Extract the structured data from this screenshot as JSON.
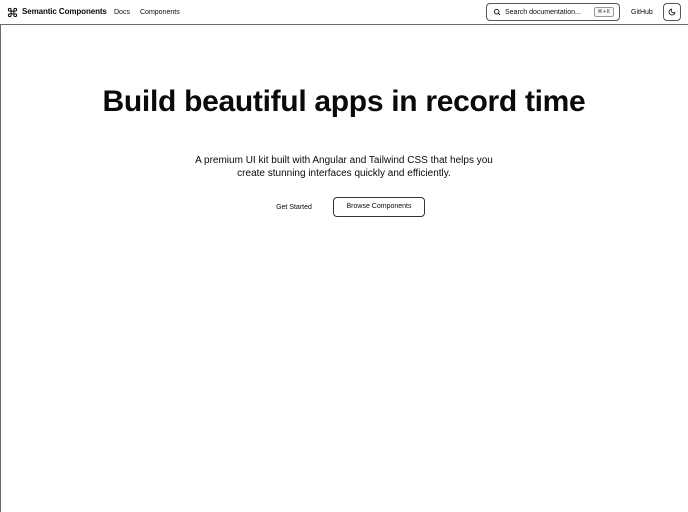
{
  "header": {
    "brand": "Semantic Components",
    "brand_icon": "command-icon",
    "nav": [
      "Docs",
      "Components"
    ],
    "search": {
      "placeholder": "Search documentation...",
      "shortcut": "⌘+K",
      "icon": "search-icon"
    },
    "github": "GitHub",
    "theme_toggle_icon": "moon-icon"
  },
  "hero": {
    "title": "Build beautiful apps in record time",
    "subtitle": "A premium UI kit built with Angular and Tailwind CSS that helps you create stunning interfaces quickly and efficiently.",
    "primary_cta": "Get Started",
    "secondary_cta": "Browse Components"
  }
}
